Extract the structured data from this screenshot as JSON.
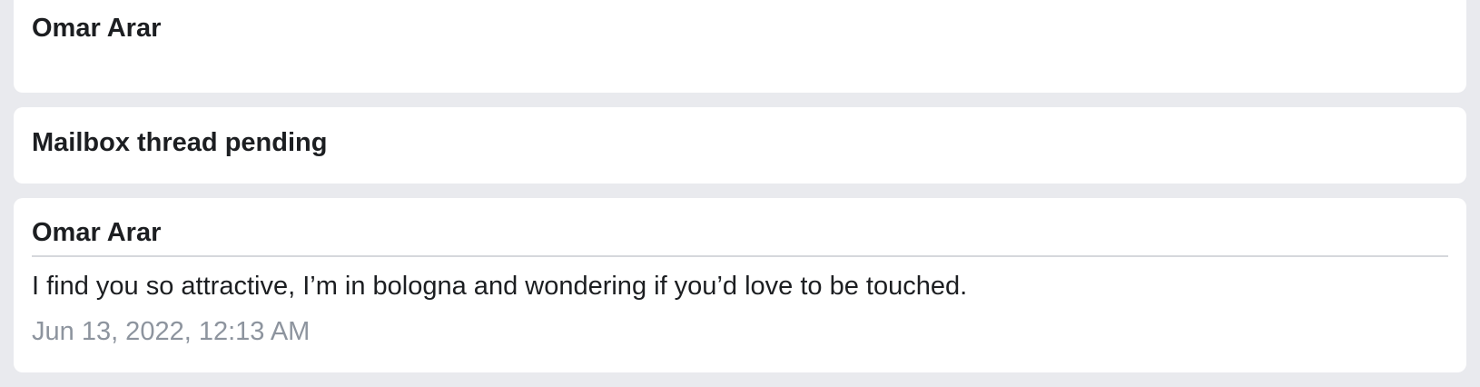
{
  "cards": [
    {
      "sender": "Omar Arar"
    },
    {
      "title": "Mailbox thread pending"
    },
    {
      "sender": "Omar Arar",
      "message": "I find you so attractive, I’m in bologna and wondering if you’d love to be touched.",
      "timestamp": "Jun 13, 2022, 12:13 AM"
    }
  ],
  "colors": {
    "page_background": "#e9eaee",
    "card_background": "#ffffff",
    "text_primary": "#1c1e21",
    "text_secondary": "#8d949e",
    "divider": "#d6d8dc"
  }
}
